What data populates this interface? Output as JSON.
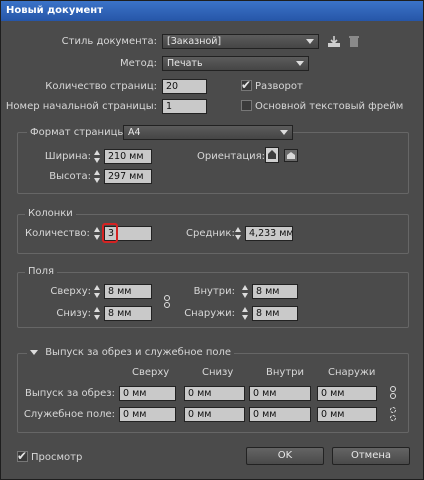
{
  "window": {
    "title": "Новый документ"
  },
  "preset": {
    "label": "Стиль документа:",
    "value": "[Заказной]"
  },
  "intent": {
    "label": "Метод:",
    "value": "Печать"
  },
  "pages": {
    "count_label": "Количество страниц:",
    "count": "20",
    "start_label": "Номер начальной страницы:",
    "start": "1",
    "facing_label": "Разворот",
    "facing_checked": true,
    "primary_frame_label": "Основной текстовый фрейм",
    "primary_frame_checked": false
  },
  "page_size": {
    "label": "Формат страницы:",
    "value": "A4",
    "width_label": "Ширина:",
    "width": "210 мм",
    "height_label": "Высота:",
    "height": "297 мм",
    "orientation_label": "Ориентация:"
  },
  "columns": {
    "group_label": "Колонки",
    "count_label": "Количество:",
    "count": "3",
    "gutter_label": "Средник:",
    "gutter": "4,233 мм"
  },
  "margins": {
    "group_label": "Поля",
    "top_label": "Сверху:",
    "top": "8 мм",
    "bottom_label": "Снизу:",
    "bottom": "8 мм",
    "inside_label": "Внутри:",
    "inside": "8 мм",
    "outside_label": "Снаружи:",
    "outside": "8 мм"
  },
  "bleed_slug": {
    "group_label": "Выпуск за обрез и служебное поле",
    "col_headers": [
      "Сверху",
      "Снизу",
      "Внутри",
      "Снаружи"
    ],
    "bleed_label": "Выпуск за обрез:",
    "bleed": [
      "0 мм",
      "0 мм",
      "0 мм",
      "0 мм"
    ],
    "slug_label": "Служебное поле:",
    "slug": [
      "0 мм",
      "0 мм",
      "0 мм",
      "0 мм"
    ]
  },
  "footer": {
    "preview_label": "Просмотр",
    "preview_checked": true,
    "ok_label": "OK",
    "cancel_label": "Отмена"
  },
  "colors": {
    "highlight": "#d52222",
    "title_bar": "#2f62b6",
    "panel": "#4b4b4b"
  }
}
